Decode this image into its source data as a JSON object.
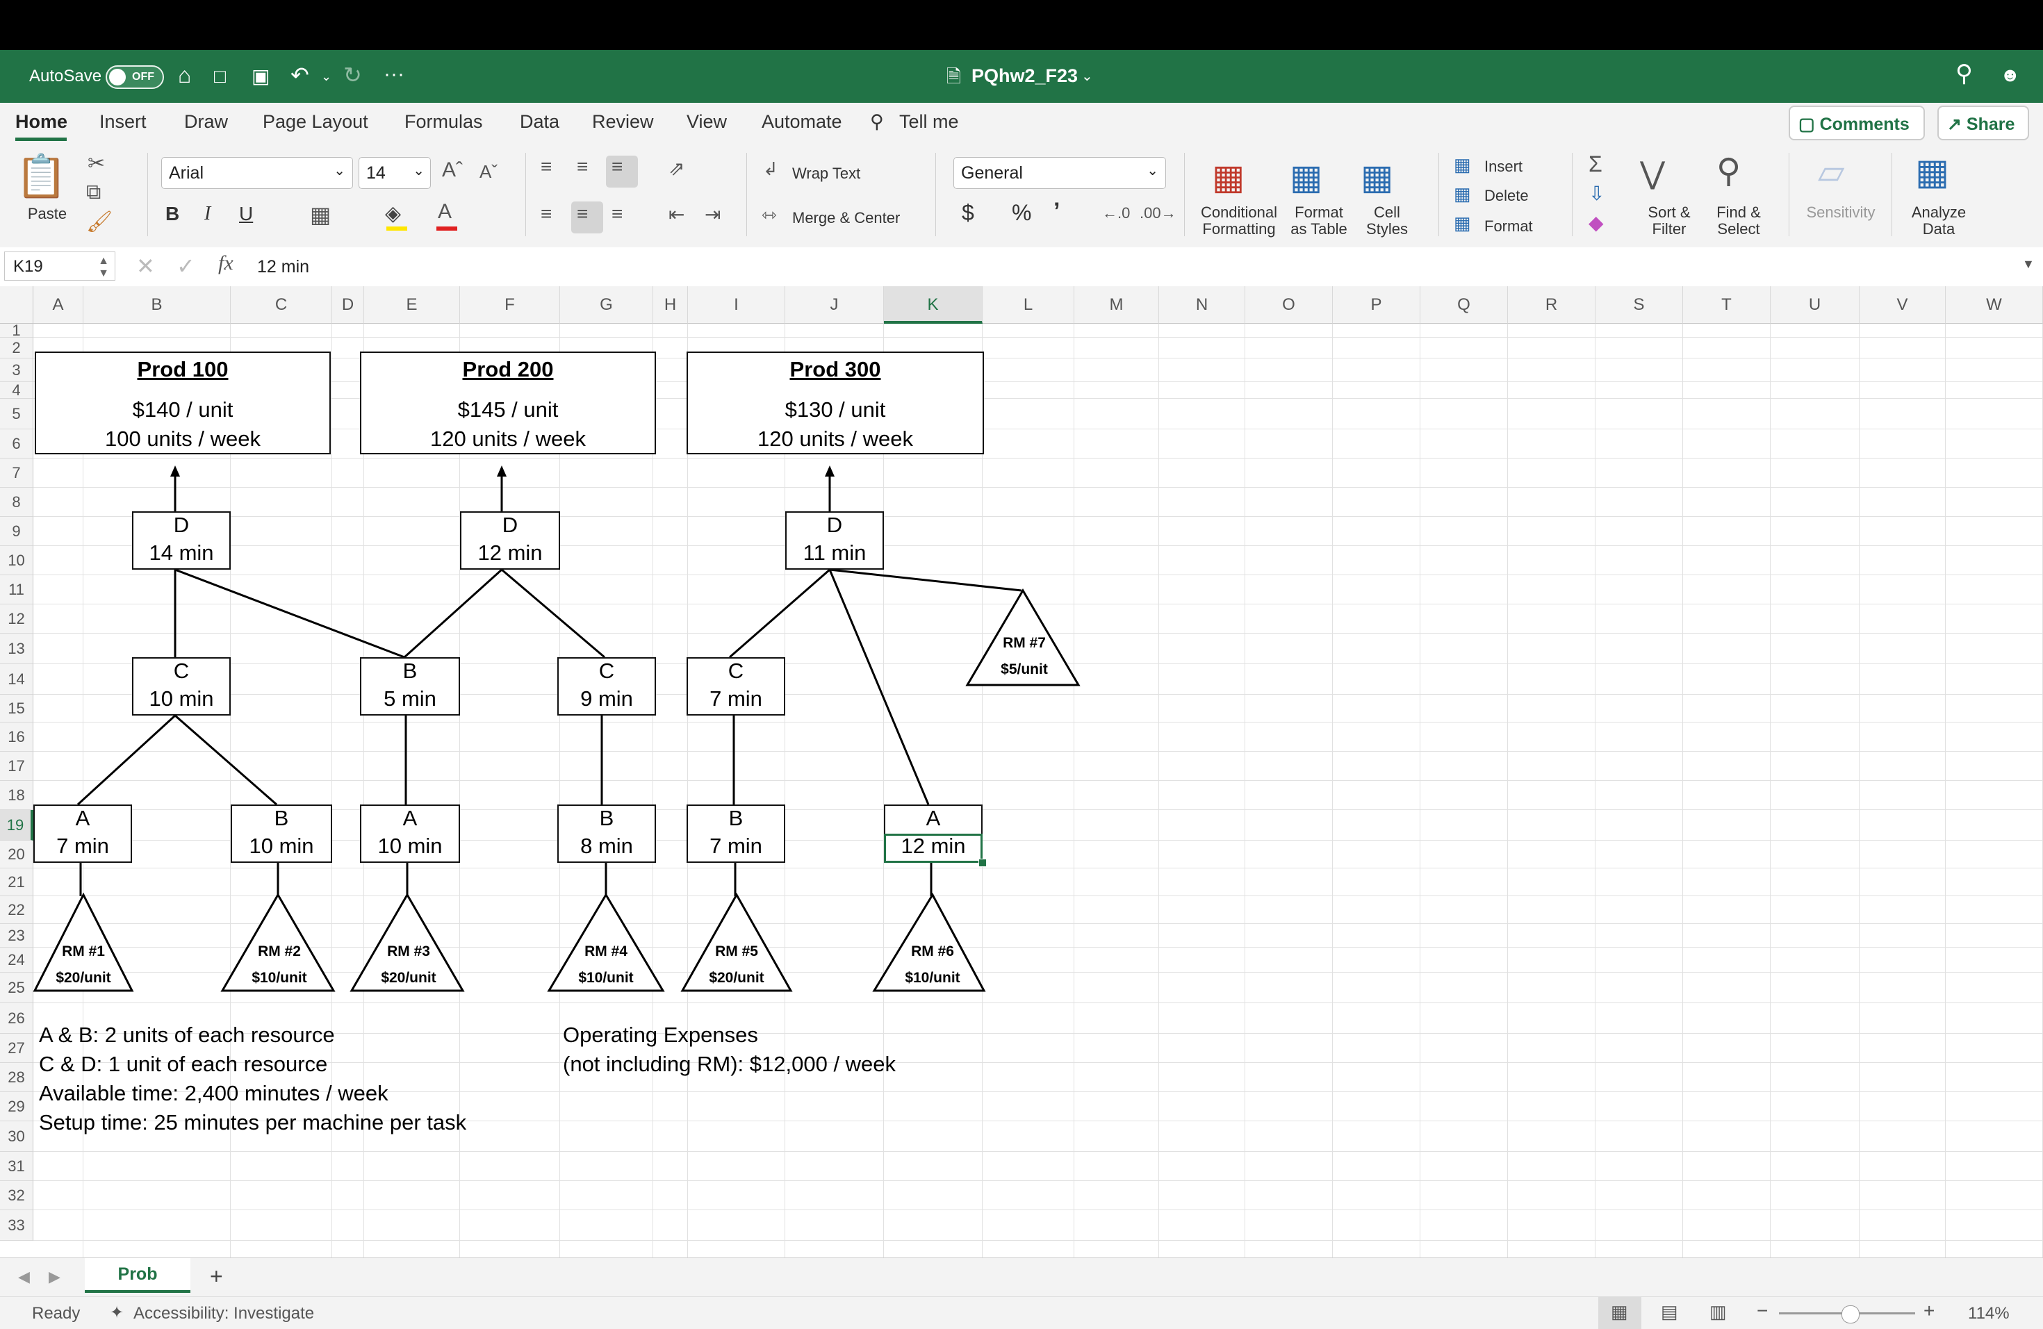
{
  "titlebar": {
    "autosave_label": "AutoSave",
    "toggle_state": "OFF",
    "file_name": "PQhw2_F23",
    "more": "···"
  },
  "ribbon_tabs": [
    "Home",
    "Insert",
    "Draw",
    "Page Layout",
    "Formulas",
    "Data",
    "Review",
    "View",
    "Automate",
    "Tell me"
  ],
  "buttons": {
    "comments": "Comments",
    "share": "Share"
  },
  "ribbon": {
    "paste": "Paste",
    "font_name": "Arial",
    "font_size": "14",
    "bold": "B",
    "italic": "I",
    "underline": "U",
    "wrap_text": "Wrap Text",
    "merge_center": "Merge & Center",
    "number_format": "General",
    "currency": "$",
    "percent": "%",
    "comma": "’",
    "conditional_1": "Conditional",
    "conditional_2": "Formatting",
    "format_table_1": "Format",
    "format_table_2": "as Table",
    "cell_styles_1": "Cell",
    "cell_styles_2": "Styles",
    "insert": "Insert",
    "delete": "Delete",
    "format": "Format",
    "sort_1": "Sort &",
    "sort_2": "Filter",
    "find_1": "Find &",
    "find_2": "Select",
    "sensitivity": "Sensitivity",
    "analyze_1": "Analyze",
    "analyze_2": "Data"
  },
  "formula_bar": {
    "cell_ref": "K19",
    "fx": "fx",
    "content": "12 min"
  },
  "columns": [
    "A",
    "B",
    "C",
    "D",
    "E",
    "F",
    "G",
    "H",
    "I",
    "J",
    "K",
    "L",
    "M",
    "N",
    "O",
    "P",
    "Q",
    "R",
    "S",
    "T",
    "U",
    "V",
    "W"
  ],
  "selected_column": "K",
  "rows": [
    "1",
    "2",
    "3",
    "4",
    "5",
    "6",
    "7",
    "8",
    "9",
    "10",
    "11",
    "12",
    "13",
    "14",
    "15",
    "16",
    "17",
    "18",
    "19",
    "20",
    "21",
    "22",
    "23",
    "24",
    "25",
    "26",
    "27",
    "28",
    "29",
    "30",
    "31",
    "32",
    "33"
  ],
  "selected_row": "19",
  "products": [
    {
      "name": "Prod 100",
      "price": "$140 / unit",
      "demand": "100 units / week"
    },
    {
      "name": "Prod 200",
      "price": "$145 / unit",
      "demand": "120 units / week"
    },
    {
      "name": "Prod 300",
      "price": "$130 / unit",
      "demand": "120 units / week"
    }
  ],
  "machines": [
    {
      "res": "D",
      "time": "14 min"
    },
    {
      "res": "D",
      "time": "12 min"
    },
    {
      "res": "D",
      "time": "11 min"
    },
    {
      "res": "C",
      "time": "10 min"
    },
    {
      "res": "B",
      "time": "5 min"
    },
    {
      "res": "C",
      "time": "9 min"
    },
    {
      "res": "C",
      "time": "7 min"
    },
    {
      "res": "A",
      "time": "7 min"
    },
    {
      "res": "B",
      "time": "10 min"
    },
    {
      "res": "A",
      "time": "10 min"
    },
    {
      "res": "B",
      "time": "8 min"
    },
    {
      "res": "B",
      "time": "7 min"
    },
    {
      "res": "A",
      "time": "12 min"
    }
  ],
  "raw_materials": [
    {
      "name": "RM #1",
      "cost": "$20/unit"
    },
    {
      "name": "RM #2",
      "cost": "$10/unit"
    },
    {
      "name": "RM #3",
      "cost": "$20/unit"
    },
    {
      "name": "RM #4",
      "cost": "$10/unit"
    },
    {
      "name": "RM #5",
      "cost": "$20/unit"
    },
    {
      "name": "RM #6",
      "cost": "$10/unit"
    },
    {
      "name": "RM #7",
      "cost": "$5/unit"
    }
  ],
  "notes": {
    "r26": "A & B: 2 units of each resource",
    "r27": "C & D: 1 unit of each resource",
    "r28": "Available time:  2,400 minutes / week",
    "r29": "Setup time: 25 minutes per machine per task",
    "op1": "Operating Expenses",
    "op2": "(not including RM): $12,000 / week"
  },
  "sheet_tab": "Prob",
  "status": {
    "ready": "Ready",
    "accessibility": "Accessibility: Investigate",
    "zoom": "114%"
  }
}
